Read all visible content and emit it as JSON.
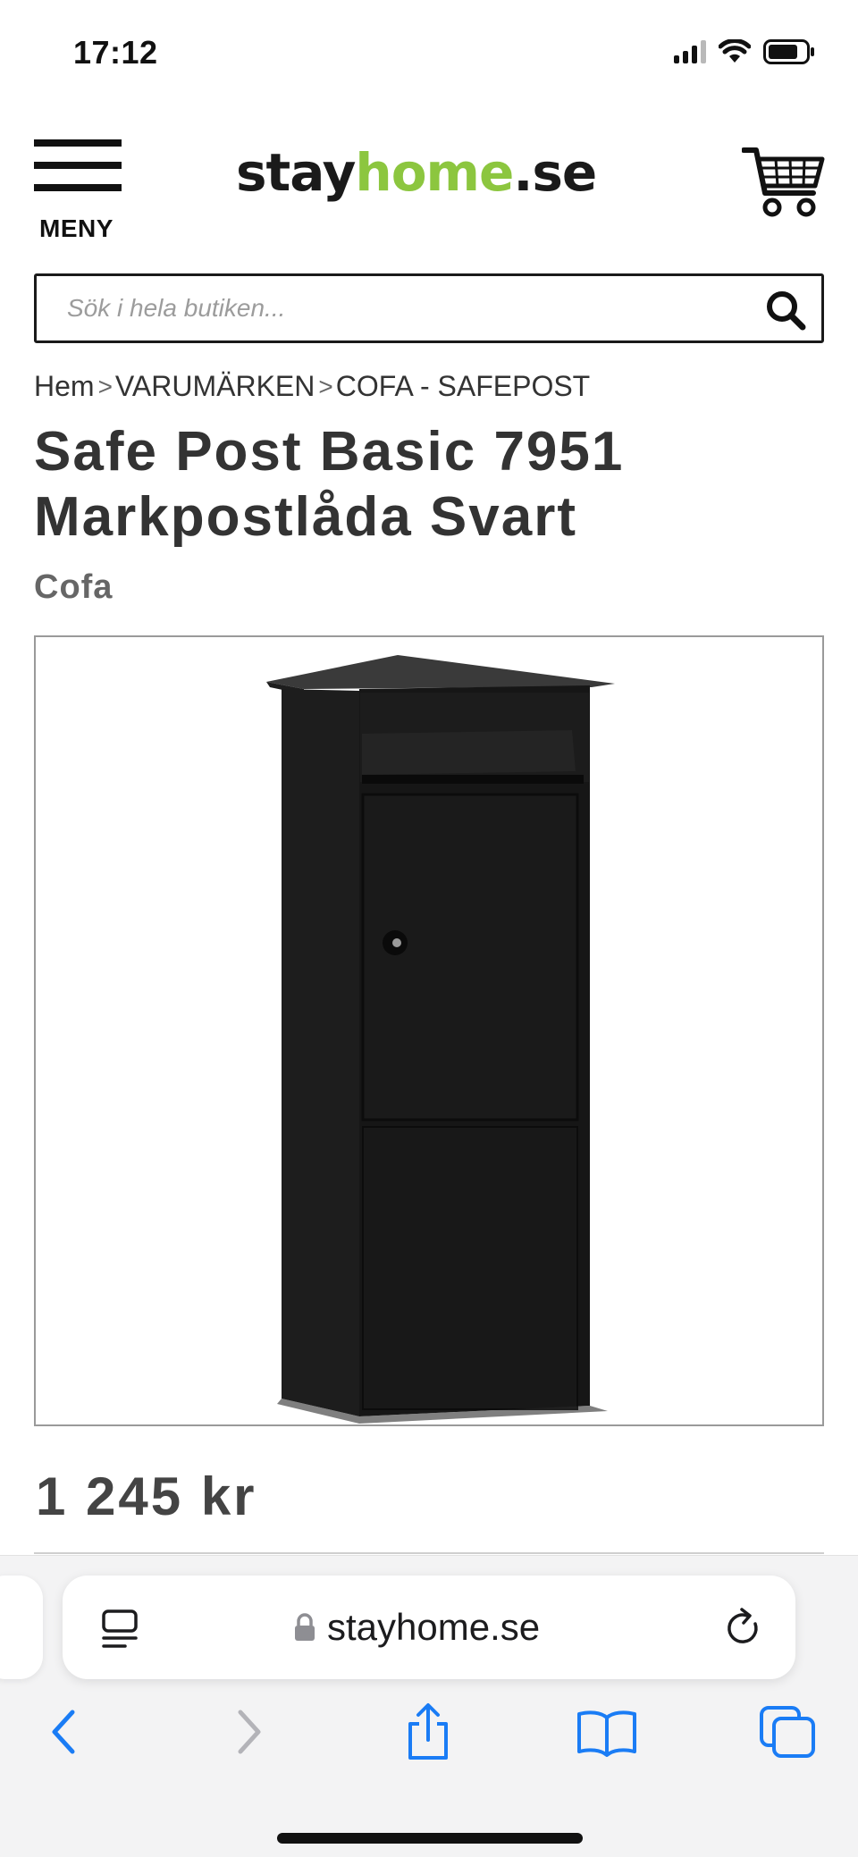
{
  "status_bar": {
    "time": "17:12",
    "icons": [
      "cellular-signal-icon",
      "wifi-icon",
      "battery-icon"
    ]
  },
  "header": {
    "menu_label": "MENY",
    "logo": {
      "part1": "stay",
      "part2": "home",
      "part3": ".se"
    },
    "cart_icon": "shopping-cart-icon"
  },
  "search": {
    "placeholder": "Sök i hela butiken...",
    "value": "",
    "icon": "search-icon"
  },
  "breadcrumb": {
    "items": [
      "Hem",
      "VARUMÄRKEN",
      "COFA - SAFEPOST"
    ],
    "separator": ">"
  },
  "product": {
    "title": "Safe Post Basic 7951 Markpostlåda Svart",
    "brand": "Cofa",
    "price": "1 245 kr",
    "image_alt": "mailbox"
  },
  "browser": {
    "url": "stayhome.se",
    "toolbar": [
      "back-icon",
      "forward-icon",
      "share-icon",
      "bookmarks-icon",
      "tabs-icon"
    ]
  },
  "colors": {
    "brand_green": "#8cc63f",
    "text_dark": "#333333",
    "ios_blue": "#1a7cf5",
    "safari_bg": "#f3f3f4"
  }
}
